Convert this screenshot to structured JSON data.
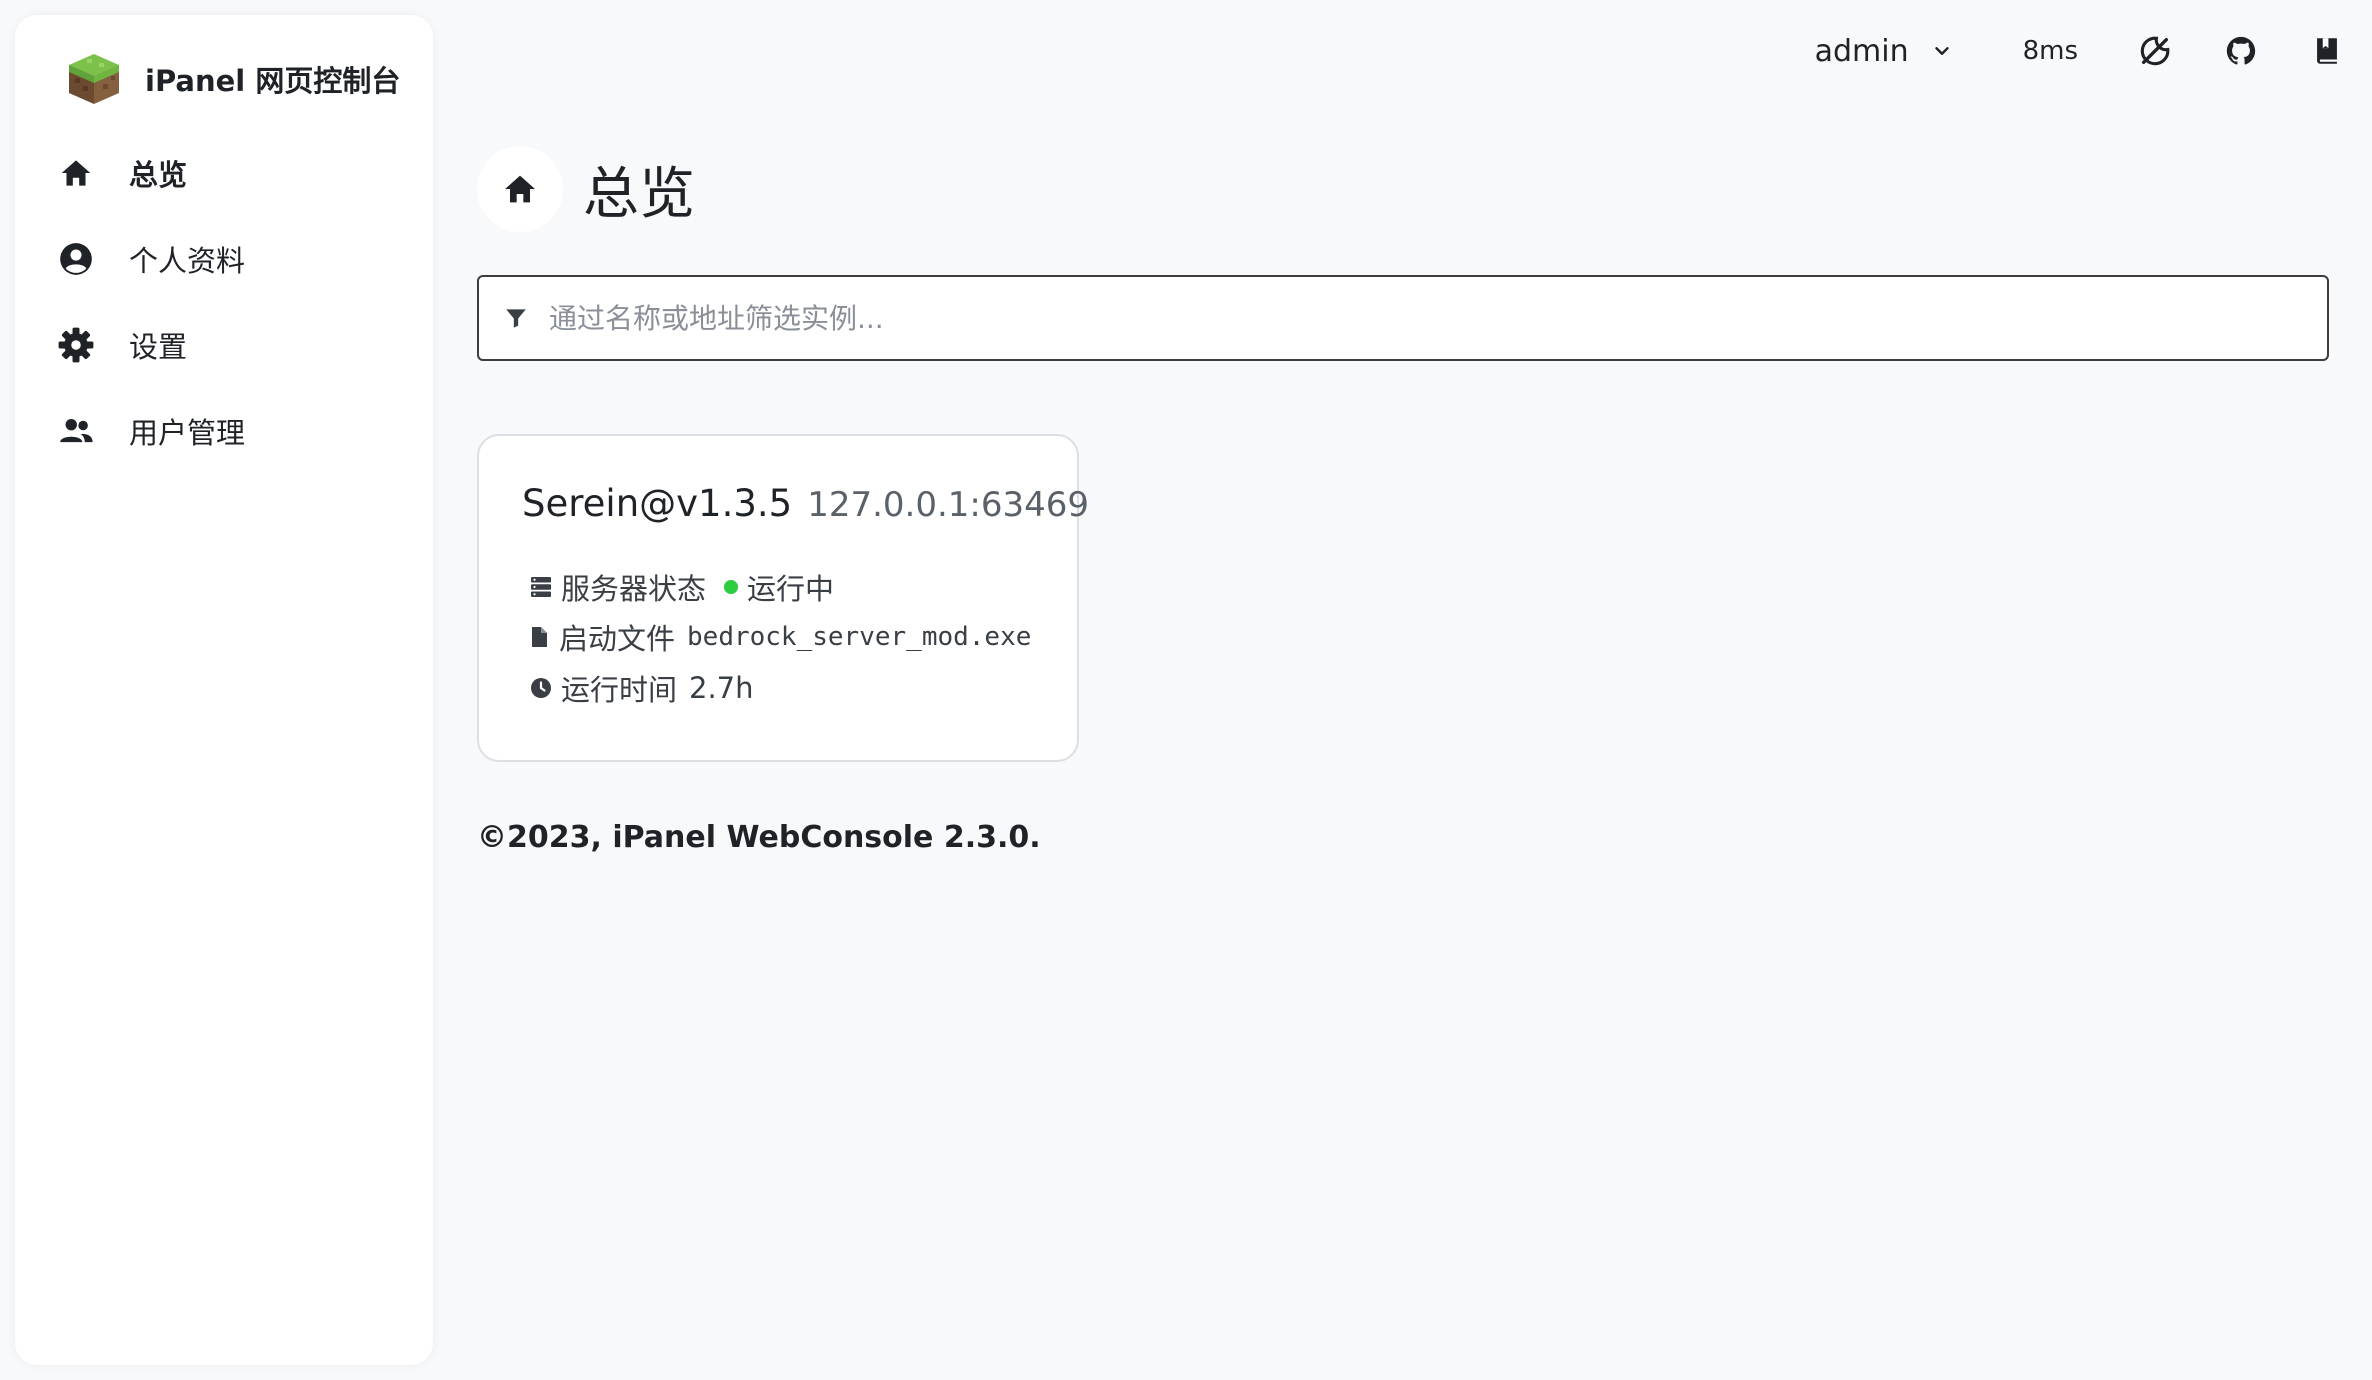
{
  "brand": {
    "title": "iPanel 网页控制台",
    "logo_icon": "grass-block-icon"
  },
  "sidebar": {
    "items": [
      {
        "label": "总览",
        "icon": "home-icon",
        "active": true
      },
      {
        "label": "个人资料",
        "icon": "user-circle-icon",
        "active": false
      },
      {
        "label": "设置",
        "icon": "gear-icon",
        "active": false
      },
      {
        "label": "用户管理",
        "icon": "users-icon",
        "active": false
      }
    ]
  },
  "topbar": {
    "username": "admin",
    "latency": "8ms",
    "icons": [
      "theme-toggle-icon",
      "github-icon",
      "book-icon"
    ]
  },
  "page": {
    "title": "总览",
    "icon": "home-icon"
  },
  "filter": {
    "placeholder": "通过名称或地址筛选实例...",
    "value": ""
  },
  "instance": {
    "name": "Serein@v1.3.5",
    "address": "127.0.0.1:63469",
    "status_label": "服务器状态",
    "status_value": "运行中",
    "status_color": "#2ecc40",
    "file_label": "启动文件",
    "file_value": "bedrock_server_mod.exe",
    "uptime_label": "运行时间",
    "uptime_value": "2.7h"
  },
  "footer": {
    "text": "©2023, iPanel WebConsole 2.3.0."
  }
}
